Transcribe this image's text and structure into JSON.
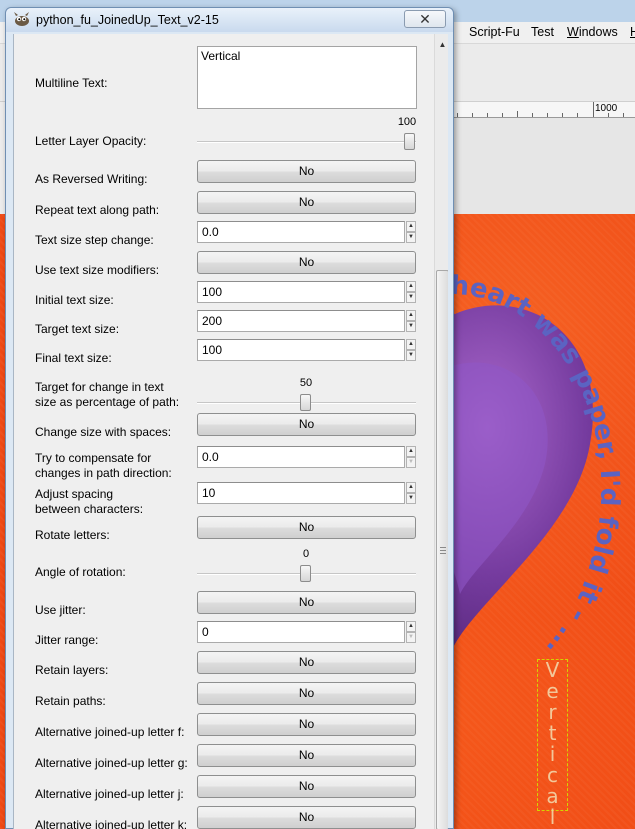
{
  "background_app": {
    "menus": [
      "Script-Fu",
      "Test",
      "Windows",
      "H"
    ],
    "ruler_label": "1000",
    "canvas": {
      "arc_text": "heart was paper, I'd fold it - ...",
      "vertical_text": [
        "V",
        "e",
        "r",
        "t",
        "i",
        "c",
        "a",
        "l"
      ]
    }
  },
  "dialog": {
    "title": "python_fu_JoinedUp_Text_v2-15",
    "close_glyph": "✕",
    "fields": {
      "multiline_text": {
        "label": "Multiline Text:",
        "value": "Vertical"
      },
      "letter_opacity": {
        "label": "Letter Layer Opacity:",
        "value": "100",
        "fraction": 1.0
      },
      "reversed_writing": {
        "label": "As Reversed Writing:",
        "value": "No"
      },
      "repeat_along_path": {
        "label": "Repeat text along path:",
        "value": "No"
      },
      "size_step_change": {
        "label": "Text size step change:",
        "value": "0.0"
      },
      "size_modifiers": {
        "label": "Use text size modifiers:",
        "value": "No"
      },
      "initial_size": {
        "label": "Initial text size:",
        "value": "100"
      },
      "target_size": {
        "label": "Target text size:",
        "value": "200"
      },
      "final_size": {
        "label": "Final text size:",
        "value": "100"
      },
      "target_change_pct": {
        "label_line1": "Target for change in text",
        "label_line2": "size as percentage of path:",
        "value": "50",
        "fraction": 0.5
      },
      "change_with_spaces": {
        "label": "Change size with spaces:",
        "value": "No"
      },
      "compensate_direction": {
        "label_line1": "Try to compensate for",
        "label_line2": "changes in path direction:",
        "value": "0.0"
      },
      "adjust_spacing": {
        "label_line1": "Adjust spacing",
        "label_line2": "between characters:",
        "value": "10"
      },
      "rotate_letters": {
        "label": "Rotate letters:",
        "value": "No"
      },
      "angle_rotation": {
        "label": "Angle of rotation:",
        "value": "0",
        "fraction": 0.5
      },
      "use_jitter": {
        "label": "Use jitter:",
        "value": "No"
      },
      "jitter_range": {
        "label": "Jitter range:",
        "value": "0"
      },
      "retain_layers": {
        "label": "Retain layers:",
        "value": "No"
      },
      "retain_paths": {
        "label": "Retain paths:",
        "value": "No"
      },
      "alt_f": {
        "label": "Alternative joined-up letter f:",
        "value": "No"
      },
      "alt_g": {
        "label": "Alternative joined-up letter g:",
        "value": "No"
      },
      "alt_j": {
        "label": "Alternative joined-up letter j:",
        "value": "No"
      },
      "alt_k": {
        "label": "Alternative joined-up letter k:",
        "value": "No"
      }
    }
  }
}
